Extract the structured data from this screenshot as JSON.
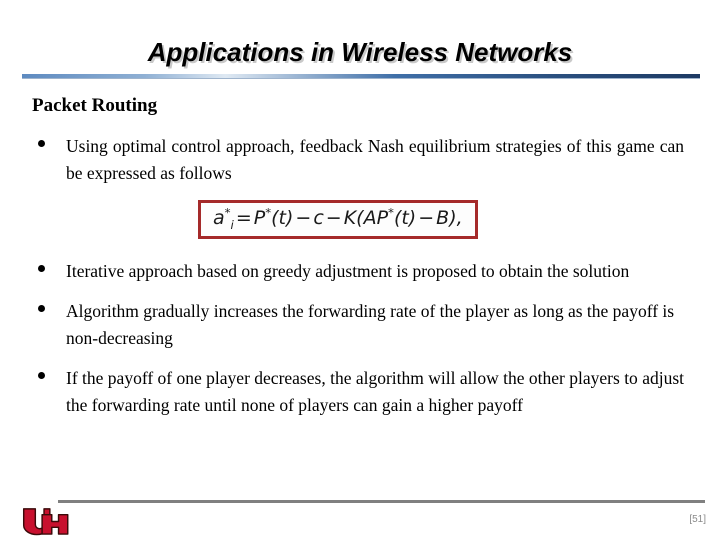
{
  "slide": {
    "title": "Applications in Wireless Networks",
    "section_heading": "Packet Routing",
    "accent_color": "#3f6fa8",
    "equation_border_color": "#a52a2a",
    "logo_color": "#c8102e",
    "footer_rule_color": "#808080",
    "page_number": "[51]"
  },
  "bullets": [
    {
      "text": "Using optimal control approach, feedback Nash equilibrium strategies of this game can be expressed as follows"
    },
    {
      "text": "Iterative approach based on greedy adjustment is proposed to obtain the solution"
    },
    {
      "text": "Algorithm gradually increases the forwarding rate of the player as long as the payoff is non-decreasing"
    },
    {
      "text": "If the payoff of one player decreases, the algorithm will allow the other players to adjust the forwarding rate until none of players can gain a higher payoff"
    }
  ],
  "equation": {
    "plain": "a_i^* = P^*(t) - c - K(AP^*(t) - B),",
    "lhs_var": "a",
    "lhs_sup": "*",
    "lhs_sub": "i",
    "parts": {
      "eq": "=",
      "p": "P",
      "p_sup": "*",
      "t1": "(t)",
      "minus1": "−",
      "c": "c",
      "minus2": "−",
      "k": "K",
      "open": "(",
      "a_cap": "A",
      "p2": "P",
      "p2_sup": "*",
      "t2": "(t)",
      "minus3": "−",
      "b": "B",
      "close": "),"
    }
  },
  "logo": {
    "name": "university-of-houston-uh-logo",
    "letters": "UH"
  }
}
